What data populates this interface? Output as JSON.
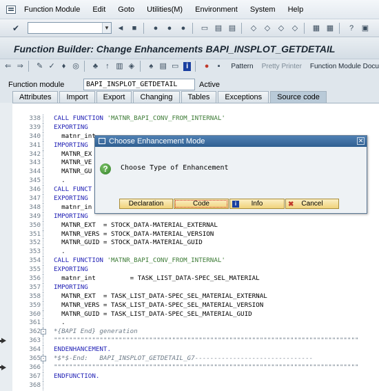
{
  "menubar": {
    "items": [
      "Function Module",
      "Edit",
      "Goto",
      "Utilities(M)",
      "Environment",
      "System",
      "Help"
    ]
  },
  "window_title": "Function Builder: Change Enhancements BAPI_INSPLOT_GETDETAIL",
  "app_toolbar": {
    "pattern": "Pattern",
    "pretty_printer": "Pretty Printer",
    "fm_doc": "Function Module Docu"
  },
  "header": {
    "fm_label": "Function module",
    "fm_value": "BAPI_INSPLOT_GETDETAIL",
    "fm_status": "Active"
  },
  "tabs": [
    "Attributes",
    "Import",
    "Export",
    "Changing",
    "Tables",
    "Exceptions",
    "Source code"
  ],
  "active_tab": "Source code",
  "code_lines": [
    {
      "n": "338",
      "t": [
        [
          "kw",
          "CALL FUNCTION "
        ],
        [
          "str",
          "'MATNR_BAPI_CONV_FROM_INTERNAL'"
        ]
      ]
    },
    {
      "n": "339",
      "t": [
        [
          "kw",
          "EXPORTING"
        ]
      ]
    },
    {
      "n": "340",
      "t": [
        [
          "",
          "  matnr_int"
        ]
      ]
    },
    {
      "n": "341",
      "t": [
        [
          "kw",
          "IMPORTING"
        ]
      ]
    },
    {
      "n": "342",
      "t": [
        [
          "",
          "  MATNR_EX"
        ]
      ]
    },
    {
      "n": "343",
      "t": [
        [
          "",
          "  MATNR_VE"
        ]
      ]
    },
    {
      "n": "344",
      "t": [
        [
          "",
          "  MATNR_GU"
        ]
      ]
    },
    {
      "n": "345",
      "t": [
        [
          "",
          "  ."
        ]
      ]
    },
    {
      "n": "346",
      "t": [
        [
          "kw",
          "CALL FUNCT"
        ]
      ]
    },
    {
      "n": "347",
      "t": [
        [
          "kw",
          "EXPORTING"
        ]
      ]
    },
    {
      "n": "348",
      "t": [
        [
          "",
          "  matnr_in"
        ]
      ]
    },
    {
      "n": "349",
      "t": [
        [
          "kw",
          "IMPORTING"
        ]
      ]
    },
    {
      "n": "350",
      "t": [
        [
          "",
          "  MATNR_EXT  = STOCK_DATA-MATERIAL_EXTERNAL"
        ]
      ]
    },
    {
      "n": "351",
      "t": [
        [
          "",
          "  MATNR_VERS = STOCK_DATA-MATERIAL_VERSION"
        ]
      ]
    },
    {
      "n": "352",
      "t": [
        [
          "",
          "  MATNR_GUID = STOCK_DATA-MATERIAL_GUID"
        ]
      ]
    },
    {
      "n": "353",
      "t": [
        [
          "",
          "  ."
        ]
      ]
    },
    {
      "n": "354",
      "t": [
        [
          "kw",
          "CALL FUNCTION "
        ],
        [
          "str",
          "'MATNR_BAPI_CONV_FROM_INTERNAL'"
        ]
      ]
    },
    {
      "n": "355",
      "t": [
        [
          "kw",
          "EXPORTING"
        ]
      ]
    },
    {
      "n": "356",
      "t": [
        [
          "",
          "  matnr_int         = TASK_LIST_DATA-SPEC_SEL_MATERIAL"
        ]
      ]
    },
    {
      "n": "357",
      "t": [
        [
          "kw",
          "IMPORTING"
        ]
      ]
    },
    {
      "n": "358",
      "t": [
        [
          "",
          "  MATNR_EXT  = TASK_LIST_DATA-SPEC_SEL_MATERIAL_EXTERNAL"
        ]
      ]
    },
    {
      "n": "359",
      "t": [
        [
          "",
          "  MATNR_VERS = TASK_LIST_DATA-SPEC_SEL_MATERIAL_VERSION"
        ]
      ]
    },
    {
      "n": "360",
      "t": [
        [
          "",
          "  MATNR_GUID = TASK_LIST_DATA-SPEC_SEL_MATERIAL_GUID"
        ]
      ]
    },
    {
      "n": "361",
      "t": [
        [
          "",
          "  ."
        ]
      ]
    },
    {
      "n": "362",
      "t": [
        [
          "cmt",
          "*{BAPI End} generation"
        ]
      ]
    },
    {
      "n": "363",
      "t": [
        [
          "cmt",
          "\"\"\"\"\"\"\"\"\"\"\"\"\"\"\"\"\"\"\"\"\"\"\"\"\"\"\"\"\"\"\"\"\"\"\"\"\"\"\"\"\"\"\"\"\"\"\"\"\"\"\"\"\"\"\"\"\"\"\"\"\"\"\"\"\"\"\"\"\"\"\"\"\"\"\"\"\"\"\"\""
        ]
      ]
    },
    {
      "n": "364",
      "t": [
        [
          "kw",
          "ENDENHANCEMENT."
        ]
      ]
    },
    {
      "n": "365",
      "t": [
        [
          "cmt",
          "*$*$-End:   BAPI_INSPLOT_GETDETAIL_G7-------------------------------"
        ]
      ]
    },
    {
      "n": "366",
      "t": [
        [
          "cmt",
          "\"\"\"\"\"\"\"\"\"\"\"\"\"\"\"\"\"\"\"\"\"\"\"\"\"\"\"\"\"\"\"\"\"\"\"\"\"\"\"\"\"\"\"\"\"\"\"\"\"\"\"\"\"\"\"\"\"\"\"\"\"\"\"\"\"\"\"\"\"\"\"\"\"\"\"\"\"\"\"\""
        ]
      ]
    },
    {
      "n": "367",
      "t": [
        [
          "kw",
          "ENDFUNCTION."
        ]
      ]
    },
    {
      "n": "368",
      "t": [
        [
          "",
          ""
        ]
      ]
    }
  ],
  "arrow_lines": [
    "363",
    "366"
  ],
  "fold_lines": [
    "362",
    "365"
  ],
  "dialog": {
    "title": "Choose Enhancement Mode",
    "message": "Choose Type of Enhancement",
    "buttons": {
      "declaration": "Declaration",
      "code": "Code",
      "info": "Info",
      "cancel": "Cancel"
    }
  }
}
